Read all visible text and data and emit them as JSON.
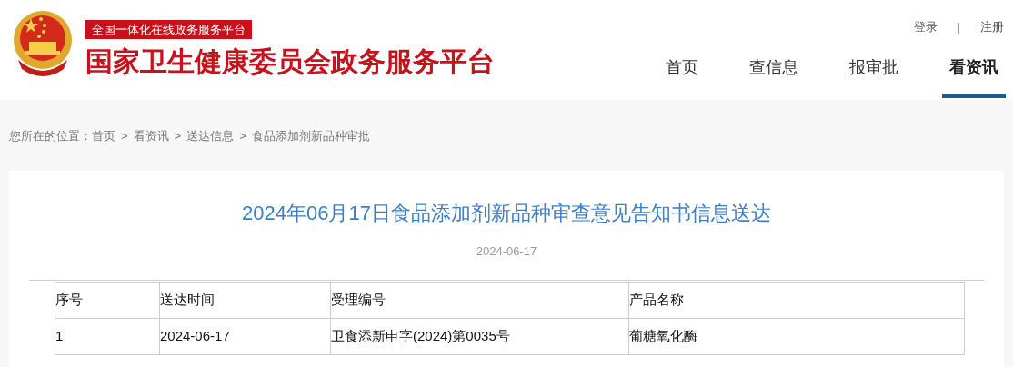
{
  "header": {
    "badge": "全国一体化在线政务服务平台",
    "site_title": "国家卫生健康委员会政务服务平台",
    "account_links": [
      "登录",
      "注册"
    ],
    "account_separator": "|"
  },
  "nav": [
    {
      "label": "首页",
      "selected": false
    },
    {
      "label": "查信息",
      "selected": false
    },
    {
      "label": "报审批",
      "selected": false
    },
    {
      "label": "看资讯",
      "selected": true
    }
  ],
  "breadcrumb": {
    "label": "您所在的位置：",
    "separator": ">",
    "items": [
      "首页",
      "看资讯",
      "送达信息",
      "食品添加剂新品种审批"
    ]
  },
  "article": {
    "title": "2024年06月17日食品添加剂新品种审查意见告知书信息送达",
    "date": "2024-06-17",
    "table": {
      "columns": [
        "序号",
        "送达时间",
        "受理编号",
        "产品名称"
      ],
      "rows": [
        [
          "1",
          "2024-06-17",
          "卫食添新申字(2024)第0035号",
          "葡糖氧化酶"
        ]
      ]
    }
  }
}
